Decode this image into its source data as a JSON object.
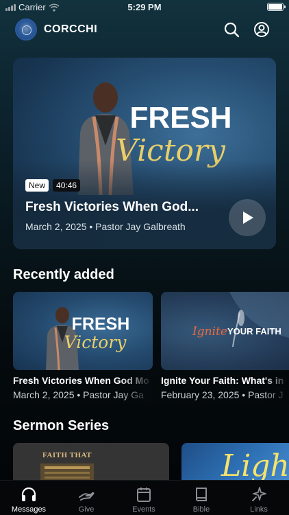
{
  "status_bar": {
    "carrier": "Carrier",
    "time": "5:29 PM"
  },
  "header": {
    "title": "CORCCHI"
  },
  "hero": {
    "artwork_line_1": "FRESH",
    "artwork_line_2": "Victory",
    "badge_new": "New",
    "duration": "40:46",
    "title": "Fresh Victories When God...",
    "meta": "March 2, 2025 • Pastor Jay Galbreath"
  },
  "recently_added": {
    "heading": "Recently added",
    "items": [
      {
        "artwork_line_1": "FRESH",
        "artwork_line_2": "Victory",
        "title": "Fresh Victories When God Mo",
        "meta": "March 2, 2025 • Pastor Jay Ga"
      },
      {
        "artwork_word_1": "Ignite",
        "artwork_word_2": "YOUR FAITH",
        "title": "Ignite Your Faith: What's in",
        "meta": "February 23, 2025 • Pastor J"
      }
    ]
  },
  "sermon_series": {
    "heading": "Sermon Series",
    "items": [
      {
        "artwork_text": "FAITH THAT"
      },
      {
        "artwork_text": "Light"
      }
    ]
  },
  "tabs": [
    {
      "label": "Messages",
      "icon": "headphones-icon",
      "active": true
    },
    {
      "label": "Give",
      "icon": "give-hand-icon",
      "active": false
    },
    {
      "label": "Events",
      "icon": "calendar-icon",
      "active": false
    },
    {
      "label": "Bible",
      "icon": "book-icon",
      "active": false
    },
    {
      "label": "Links",
      "icon": "sparkle-icon",
      "active": false
    }
  ],
  "colors": {
    "accent": "#ffffff",
    "artwork_gold": "#e8cf6a",
    "ignite_orange": "#e96a3c"
  }
}
